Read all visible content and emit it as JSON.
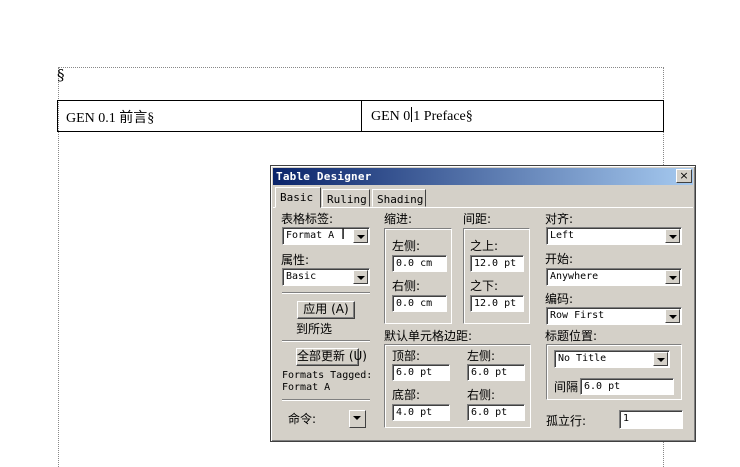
{
  "document": {
    "para_mark": "§",
    "cell1": "GEN 0.1 前言§",
    "cell2_before_caret": "GEN 0",
    "cell2_after_caret": "1 Preface§"
  },
  "dialog": {
    "title": "Table Designer",
    "close_glyph": "×",
    "tabs": [
      "Basic",
      "Ruling",
      "Shading"
    ],
    "table_tag_label": "表格标签:",
    "table_tag_value": "Format A",
    "attribute_label": "属性:",
    "attribute_value": "Basic",
    "apply_button": "应用 (A)",
    "to_selection_label": "到所选",
    "update_all_button": "全部更新 (U)",
    "formats_tagged_label": "Formats Tagged:",
    "formats_tagged_value": "Format A",
    "command_label": "命令:",
    "indent": {
      "label": "缩进:",
      "left_label": "左侧:",
      "left_value": "0.0 cm",
      "right_label": "右侧:",
      "right_value": "0.0 cm"
    },
    "spacing": {
      "label": "间距:",
      "above_label": "之上:",
      "above_value": "12.0 pt",
      "below_label": "之下:",
      "below_value": "12.0 pt"
    },
    "cell_margins": {
      "label": "默认单元格边距:",
      "top_label": "顶部:",
      "top_value": "6.0 pt",
      "left_label": "左侧:",
      "left_value": "6.0 pt",
      "bottom_label": "底部:",
      "bottom_value": "4.0 pt",
      "right_label": "右侧:",
      "right_value": "6.0 pt"
    },
    "alignment_label": "对齐:",
    "alignment_value": "Left",
    "start_label": "开始:",
    "start_value": "Anywhere",
    "numbering_label": "编码:",
    "numbering_value": "Row First",
    "title_position_label": "标题位置:",
    "title_position_value": "No Title",
    "gap_label": "间隔",
    "gap_value": "6.0 pt",
    "orphan_rows_label": "孤立行:",
    "orphan_rows_value": "1"
  },
  "colors": {
    "dialog_face": "#d4d0c8",
    "titlebar_start": "#0a246a",
    "titlebar_end": "#a6caf0"
  }
}
